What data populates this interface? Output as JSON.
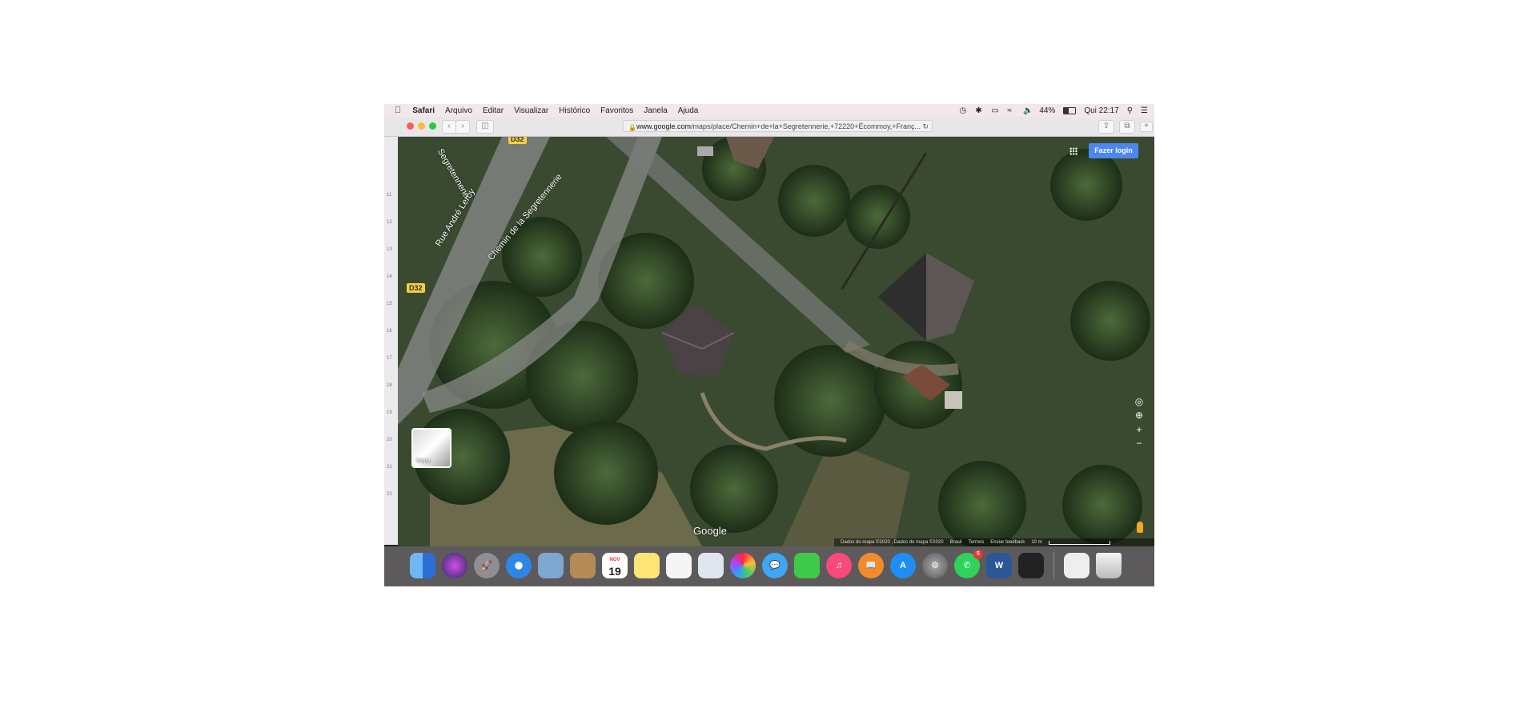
{
  "menubar": {
    "app": "Safari",
    "items": [
      "Arquivo",
      "Editar",
      "Visualizar",
      "Histórico",
      "Favoritos",
      "Janela",
      "Ajuda"
    ],
    "battery": "44%",
    "clock": "Qui 22:17"
  },
  "browser": {
    "url_host": "www.google.com",
    "url_path": "/maps/place/Chemin+de+la+Segretennerie,+72220+Écommoy,+Franç..."
  },
  "sidebar": {
    "ruler_ticks": [
      "11",
      "12",
      "13",
      "14",
      "15",
      "16",
      "17",
      "18",
      "19",
      "20",
      "21",
      "22"
    ]
  },
  "map": {
    "roads": {
      "segretennerie_top": "Segretennerie",
      "andre_leroy": "Rue André Leroy",
      "chemin": "Chemin de la Segretennerie"
    },
    "route_badges": [
      "D32",
      "D32"
    ],
    "login_label": "Fazer login",
    "layer_label": "Mapa",
    "logo": "Google",
    "footer": {
      "data": "Dados do mapa ©2020 , Dados do mapa ©2020",
      "country": "Brasil",
      "terms": "Termos",
      "feedback": "Enviar feedback",
      "scale": "10 m"
    },
    "controls": {
      "zoom_in": "+",
      "zoom_out": "−"
    }
  },
  "dock": {
    "calendar_month": "NOV",
    "calendar_day": "19",
    "whatsapp_badge": "5",
    "word_letter": "W"
  },
  "colors": {
    "login_button": "#4a87f0",
    "route_badge": "#f4d03f",
    "menubar_bg": "#f3e7e9"
  }
}
